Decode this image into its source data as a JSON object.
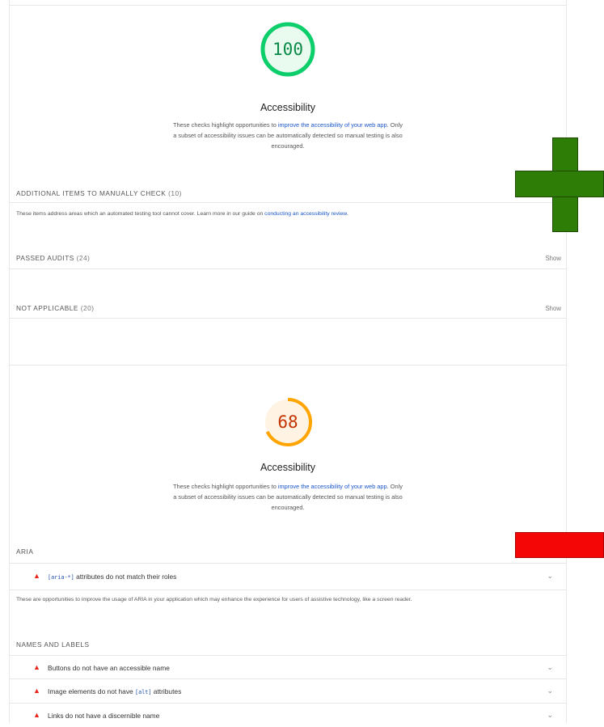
{
  "report_a": {
    "score": "100",
    "score_color": "#0cce6b",
    "title": "Accessibility",
    "desc_pre": "These checks highlight opportunities to ",
    "desc_link": "improve the accessibility of your web app",
    "desc_post": ". Only a subset of accessibility issues can be automatically detected so manual testing is also encouraged.",
    "manual_title": "ADDITIONAL ITEMS TO MANUALLY CHECK",
    "manual_count": "(10)",
    "manual_desc_pre": "These items address areas which an automated testing tool cannot cover. Learn more in our guide on ",
    "manual_desc_link": "conducting an accessibility review",
    "manual_desc_post": ".",
    "passed_title": "PASSED AUDITS",
    "passed_count": "(24)",
    "passed_show": "Show",
    "na_title": "NOT APPLICABLE",
    "na_count": "(20)",
    "na_show": "Show"
  },
  "report_b": {
    "score": "68",
    "score_fraction": 0.68,
    "score_color": "#ffa400",
    "title": "Accessibility",
    "desc_pre": "These checks highlight opportunities to ",
    "desc_link": "improve the accessibility of your web app",
    "desc_post": ". Only a subset of accessibility issues can be automatically detected so manual testing is also encouraged.",
    "aria_title": "ARIA",
    "aria_audits": [
      {
        "code": "[aria-*]",
        "text": " attributes do not match their roles"
      }
    ],
    "aria_desc": "These are opportunities to improve the usage of ARIA in your application which may enhance the experience for users of assistive technology, like a screen reader.",
    "names_title": "NAMES AND LABELS",
    "names_audits": [
      {
        "text": "Buttons do not have an accessible name"
      },
      {
        "text": "Image elements do not have ",
        "code": "[alt]",
        "text2": " attributes"
      },
      {
        "text": "Links do not have a discernible name"
      }
    ]
  },
  "overlays": {
    "plus_color": "#2e7d07",
    "bar_color": "#f40606"
  }
}
